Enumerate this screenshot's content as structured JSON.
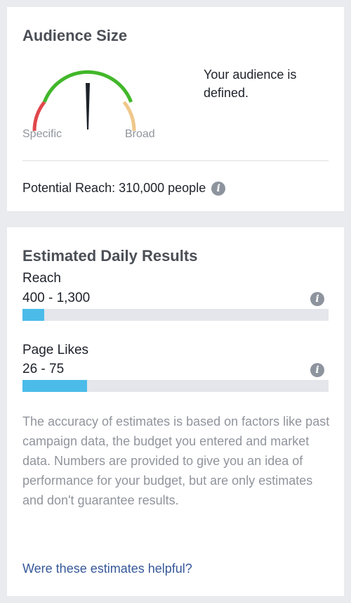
{
  "audience": {
    "title": "Audience Size",
    "gauge": {
      "left_label": "Specific",
      "right_label": "Broad",
      "colors": {
        "narrow": "#e0474c",
        "defined": "#42b72a",
        "broad": "#f0c78a",
        "needle": "#1d2129"
      }
    },
    "status": "Your audience is defined.",
    "potential_reach": "Potential Reach: 310,000 people",
    "info_icon": "info-icon"
  },
  "results": {
    "title": "Estimated Daily Results",
    "metrics": [
      {
        "label": "Reach",
        "range": "400 - 1,300",
        "fill_percent": 7,
        "info_icon": "info-icon"
      },
      {
        "label": "Page Likes",
        "range": "26 - 75",
        "fill_percent": 21,
        "info_icon": "info-icon"
      }
    ],
    "bar_color": "#4bbce9",
    "disclaimer": "The accuracy of estimates is based on factors like past campaign data, the budget you entered and market data. Numbers are provided to give you an idea of performance for your budget, but are only estimates and don't guarantee results.",
    "feedback_link": "Were these estimates helpful?",
    "link_color": "#365899"
  }
}
